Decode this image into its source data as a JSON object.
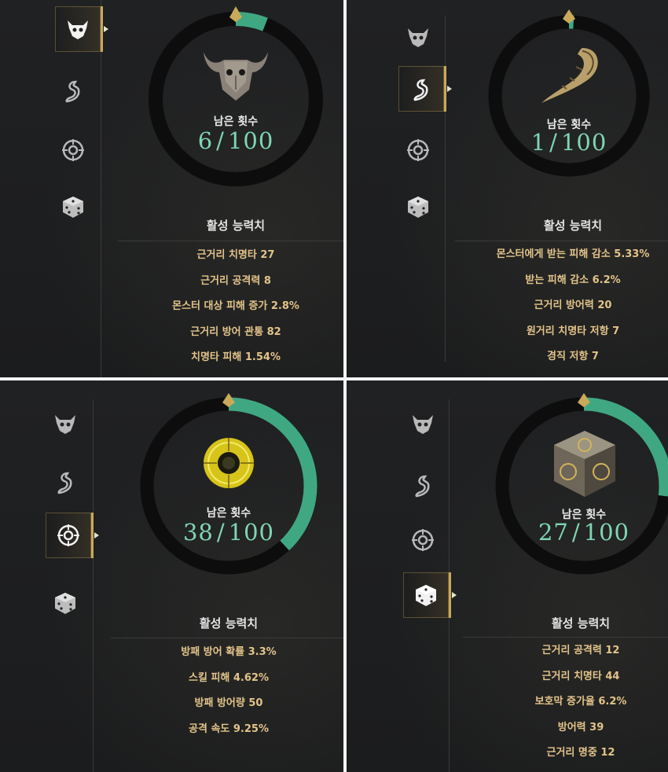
{
  "remaining_label": "남은 횟수",
  "stats_title": "활성 능력치",
  "colors": {
    "progress": "#3fa882",
    "track": "#0d0d0d",
    "count_text": "#7fd6b3",
    "stat_text": "#e3c48a",
    "active_tab_border": "#c9a95a"
  },
  "tab_icons": [
    "bull-emblem-icon",
    "horn-emblem-icon",
    "eye-emblem-icon",
    "dice-emblem-icon"
  ],
  "panels": [
    {
      "active_tab": 0,
      "item_icon": "bull-skull-icon",
      "remaining": 6,
      "total": 100,
      "progress": 0.06,
      "count_sep": "/",
      "stats": [
        "근거리 치명타 27",
        "근거리 공격력 8",
        "몬스터 대상 피해 증가 2.8%",
        "근거리 방어 관통 82",
        "치명타 피해 1.54%"
      ]
    },
    {
      "active_tab": 1,
      "item_icon": "horn-icon",
      "remaining": 1,
      "total": 100,
      "progress": 0.01,
      "count_sep": "/",
      "stats": [
        "몬스터에게 받는 피해 감소 5.33%",
        "받는 피해 감소 6.2%",
        "근거리 방어력 20",
        "원거리 치명타 저항 7",
        "경직 저항 7"
      ]
    },
    {
      "active_tab": 2,
      "item_icon": "golden-eye-orb-icon",
      "remaining": 38,
      "total": 100,
      "progress": 0.38,
      "count_sep": "/",
      "stats": [
        "방패 방어 확률 3.3%",
        "스킬 피해 4.62%",
        "방패 방어량 50",
        "공격 속도 9.25%"
      ]
    },
    {
      "active_tab": 3,
      "item_icon": "runic-dice-icon",
      "remaining": 27,
      "total": 100,
      "progress": 0.27,
      "count_sep": "/",
      "stats": [
        "근거리 공격력 12",
        "근거리 치명타 44",
        "보호막 증가율 6.2%",
        "방어력 39",
        "근거리 명중 12"
      ]
    }
  ]
}
